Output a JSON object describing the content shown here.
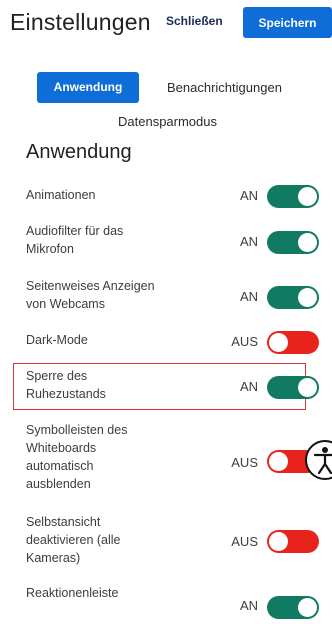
{
  "header": {
    "title": "Einstellungen",
    "close_label": "Schließen",
    "save_label": "Speichern"
  },
  "tabs": [
    {
      "label": "Anwendung",
      "active": true
    },
    {
      "label": "Benachrichtigungen",
      "active": false
    },
    {
      "label": "Datensparmodus",
      "active": false
    }
  ],
  "section": {
    "title": "Anwendung"
  },
  "settings": [
    {
      "label": "Animationen",
      "state": "AN",
      "on": true
    },
    {
      "label": "Audiofilter für das Mikrofon",
      "state": "AN",
      "on": true
    },
    {
      "label": "Seitenweises Anzeigen von Webcams",
      "state": "AN",
      "on": true
    },
    {
      "label": "Dark-Mode",
      "state": "AUS",
      "on": false
    },
    {
      "label": "Sperre des Ruhezustands",
      "state": "AN",
      "on": true
    },
    {
      "label": "Symbolleisten des Whiteboards automatisch ausblenden",
      "state": "AUS",
      "on": false
    },
    {
      "label": "Selbstansicht deaktivieren (alle Kameras)",
      "state": "AUS",
      "on": false
    },
    {
      "label": "Reaktionenleiste",
      "state": "AN",
      "on": true
    }
  ],
  "colors": {
    "accent": "#0f6dd7",
    "toggle_on": "#117a62",
    "toggle_off": "#e8231c",
    "highlight": "#d9343a"
  },
  "icons": {
    "accessibility": "accessibility-icon"
  }
}
